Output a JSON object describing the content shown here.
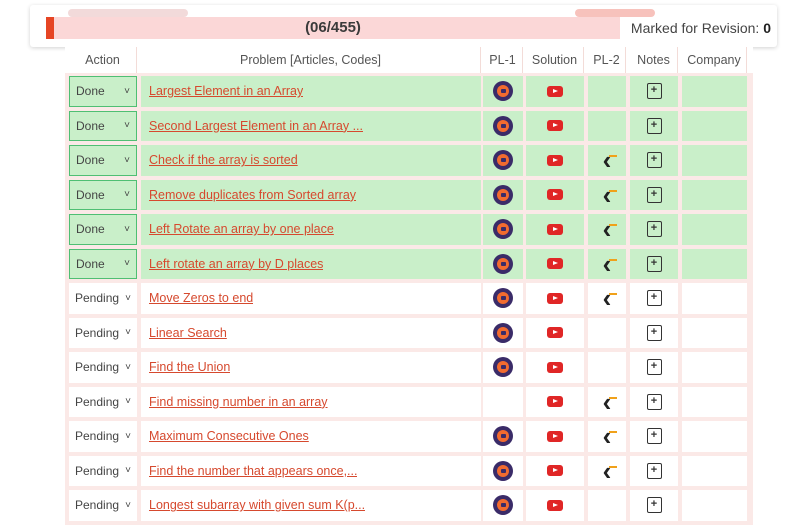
{
  "header": {
    "progress_text": "(06/455)",
    "progress_fraction": 0.0132,
    "revision_label": "Marked for Revision:",
    "revision_count": "0"
  },
  "columns": [
    "Action",
    "Problem [Articles, Codes]",
    "PL-1",
    "Solution",
    "PL-2",
    "Notes",
    "Company"
  ],
  "icons": {
    "pl1": "codingninjas-icon",
    "solution": "youtube-play-icon",
    "pl2": "leetcode-icon",
    "notes": "note-add-icon"
  },
  "colors": {
    "accent": "#e64524",
    "done_row": "#c9efc9",
    "link": "#d6492e"
  },
  "rows": [
    {
      "status": "Done",
      "title": "Largest Element in an Array",
      "pl1": true,
      "solution": true,
      "pl2": false
    },
    {
      "status": "Done",
      "title": "Second Largest Element in an Array ...",
      "pl1": true,
      "solution": true,
      "pl2": false
    },
    {
      "status": "Done",
      "title": "Check if the array is sorted",
      "pl1": true,
      "solution": true,
      "pl2": true
    },
    {
      "status": "Done",
      "title": "Remove duplicates from Sorted array",
      "pl1": true,
      "solution": true,
      "pl2": true
    },
    {
      "status": "Done",
      "title": "Left Rotate an array by one place",
      "pl1": true,
      "solution": true,
      "pl2": true
    },
    {
      "status": "Done",
      "title": "Left rotate an array by D places",
      "pl1": true,
      "solution": true,
      "pl2": true
    },
    {
      "status": "Pending",
      "title": "Move Zeros to end",
      "pl1": true,
      "solution": true,
      "pl2": true
    },
    {
      "status": "Pending",
      "title": "Linear Search",
      "pl1": true,
      "solution": true,
      "pl2": false
    },
    {
      "status": "Pending",
      "title": "Find the Union",
      "pl1": true,
      "solution": true,
      "pl2": false
    },
    {
      "status": "Pending",
      "title": "Find missing number in an array",
      "pl1": false,
      "solution": true,
      "pl2": true
    },
    {
      "status": "Pending",
      "title": "Maximum Consecutive Ones",
      "pl1": true,
      "solution": true,
      "pl2": true
    },
    {
      "status": "Pending",
      "title": "Find the number that appears once,...",
      "pl1": true,
      "solution": true,
      "pl2": true
    },
    {
      "status": "Pending",
      "title": "Longest subarray with given sum K(p...",
      "pl1": true,
      "solution": true,
      "pl2": false
    }
  ]
}
